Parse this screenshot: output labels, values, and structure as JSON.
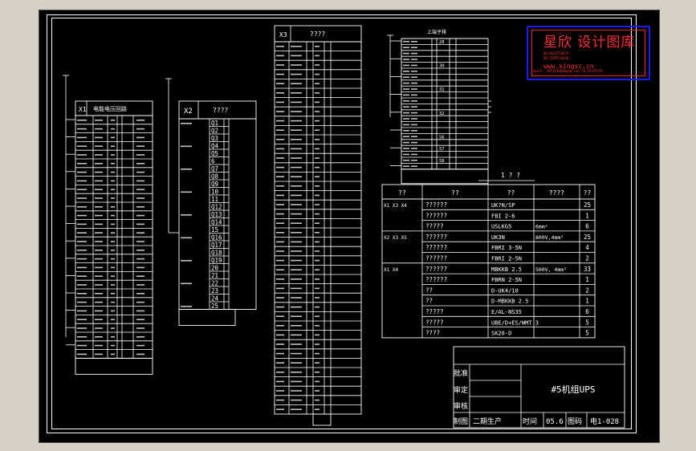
{
  "colors": {
    "background": "#000000",
    "lines": "#ffffff",
    "watermark": "#ff3030",
    "watermark_border": "#1a1aff"
  },
  "watermark": {
    "title": "星欣 设计图库",
    "line1": "QQ:8613734625",
    "line2": "QQ:1590733426",
    "url": "www.xingsc.cn",
    "mail": "Email: 1051198048@qq.com 7k:13737474"
  },
  "panel_x1": {
    "header_code": "X1",
    "header_title": "电能电压回路",
    "row_count": 28
  },
  "panel_x2": {
    "header_code": "X2",
    "header_title": "????",
    "terminals": [
      "Q1",
      "Q2",
      "Q3",
      "Q4",
      "Q5",
      "6",
      "Q7",
      "Q8",
      "Q9",
      "10",
      "11",
      "Q12",
      "Q13",
      "Q14",
      "15",
      "Q16",
      "Q17",
      "Q18",
      "Q19",
      "20",
      "21",
      "22",
      "23",
      "24",
      "25"
    ]
  },
  "panel_x3": {
    "header_code": "X3",
    "header_title": "????",
    "row_count": 40
  },
  "panel_x4": {
    "header_title": "上端子排",
    "numbers": [
      "28",
      "",
      "",
      "",
      "30",
      "",
      "",
      "",
      "31",
      "",
      "",
      "",
      "32",
      "",
      "",
      "",
      "56",
      "",
      "57",
      "",
      "58",
      ""
    ]
  },
  "material_table": {
    "title": "1 ? ?",
    "headers": [
      "??",
      "??",
      "??",
      "????",
      "??"
    ],
    "rows": [
      {
        "group": "X1 X3 X4",
        "name": "??????",
        "model": "UK?N/SP",
        "spec": "",
        "qty": "25"
      },
      {
        "group": "",
        "name": "??????",
        "model": "FBI 2-6",
        "spec": "",
        "qty": "1"
      },
      {
        "group": "",
        "name": "?????",
        "model": "USLKG5",
        "spec": "6mm²",
        "qty": "6"
      },
      {
        "group": "X2 X3 X5",
        "name": "??????",
        "model": "UK3N",
        "spec": "800V,4mm²",
        "qty": "25"
      },
      {
        "group": "",
        "name": "??????",
        "model": "FBRI 3-5N",
        "spec": "",
        "qty": "4"
      },
      {
        "group": "",
        "name": "??????",
        "model": "FBRI 2-5N",
        "spec": "",
        "qty": "2"
      },
      {
        "group": "X1 X4",
        "name": "??????",
        "model": "MBKKB 2.5",
        "spec": "500V, 4mm²",
        "qty": "33"
      },
      {
        "group": "",
        "name": "??????",
        "model": "FBRN 2-5N",
        "spec": "",
        "qty": "1"
      },
      {
        "group": "",
        "name": "??",
        "model": "D-UK4/10",
        "spec": "",
        "qty": "2"
      },
      {
        "group": "",
        "name": "??",
        "model": "D-MBKKB 2.5",
        "spec": "",
        "qty": "1"
      },
      {
        "group": "",
        "name": "?????",
        "model": "E/AL-NS35",
        "spec": "",
        "qty": "6"
      },
      {
        "group": "",
        "name": "?????",
        "model": "UBE/D+ES/WMT 3",
        "spec": "",
        "qty": "5"
      },
      {
        "group": "",
        "name": "????",
        "model": "SK20-D",
        "spec": "",
        "qty": "5"
      }
    ]
  },
  "title_block": {
    "approve": "批准",
    "check": "审定",
    "review": "审核",
    "draw": "制图",
    "drafter": "二期生产",
    "time_label": "时间",
    "time_value": "05.6",
    "code_label": "图码",
    "drawing_no": "电1-028",
    "project": "#5机组UPS"
  }
}
